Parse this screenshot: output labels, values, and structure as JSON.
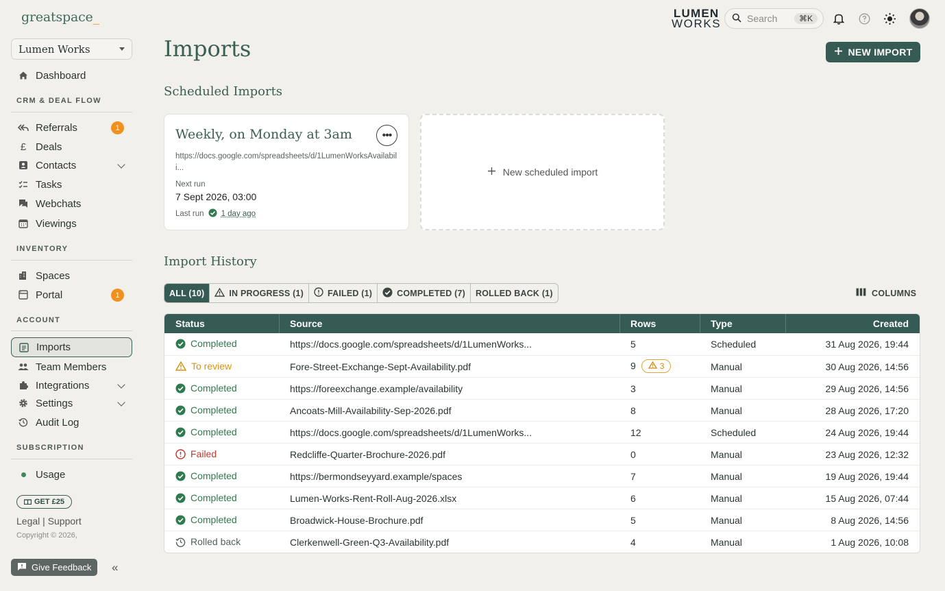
{
  "brand": {
    "name": "greatspace",
    "cursor": "_"
  },
  "org_select": {
    "value": "Lumen Works"
  },
  "sidebar": {
    "dashboard": "Dashboard",
    "crm_section": "CRM & DEAL FLOW",
    "referrals": "Referrals",
    "referrals_badge": "1",
    "deals": "Deals",
    "contacts": "Contacts",
    "tasks": "Tasks",
    "webchats": "Webchats",
    "viewings": "Viewings",
    "inventory_section": "INVENTORY",
    "spaces": "Spaces",
    "portal": "Portal",
    "portal_badge": "1",
    "account_section": "ACCOUNT",
    "imports": "Imports",
    "team_members": "Team Members",
    "integrations": "Integrations",
    "settings": "Settings",
    "audit_log": "Audit Log",
    "subscription_section": "SUBSCRIPTION",
    "usage": "Usage",
    "get_offer": "GET £25",
    "legal": "Legal",
    "support": "Support",
    "copyright": "Copyright © 2026,",
    "feedback": "Give Feedback",
    "collapse": "«"
  },
  "topbar": {
    "client_logo_line1": "LUMEN",
    "client_logo_line2": "WORKS",
    "search_placeholder": "Search",
    "search_shortcut": "⌘K"
  },
  "page": {
    "title": "Imports",
    "new_import_label": "NEW IMPORT",
    "scheduled_heading": "Scheduled Imports",
    "history_heading": "Import History"
  },
  "scheduled_card": {
    "title": "Weekly, on Monday at 3am",
    "url": "https://docs.google.com/spreadsheets/d/1LumenWorksAvailabili...",
    "next_run_label": "Next run",
    "next_run_value": "7 Sept 2026, 03:00",
    "last_run_label": "Last run",
    "last_run_value": "1 day ago"
  },
  "new_scheduled_label": "New scheduled import",
  "filters": [
    {
      "label": "ALL (10)",
      "icon": "none"
    },
    {
      "label": "IN PROGRESS (1)",
      "icon": "warning-icon"
    },
    {
      "label": "FAILED (1)",
      "icon": "alert-circle-icon"
    },
    {
      "label": "COMPLETED (7)",
      "icon": "check-circle-icon"
    },
    {
      "label": "ROLLED BACK (1)",
      "icon": "none"
    }
  ],
  "columns_label": "COLUMNS",
  "table": {
    "headers": {
      "status": "Status",
      "source": "Source",
      "rows": "Rows",
      "type": "Type",
      "created": "Created"
    },
    "rows": [
      {
        "status": "Completed",
        "source": "https://docs.google.com/spreadsheets/d/1LumenWorks...",
        "rows": "5",
        "type": "Scheduled",
        "created": "31 Aug 2026, 19:44"
      },
      {
        "status": "To review",
        "source": "Fore-Street-Exchange-Sept-Availability.pdf",
        "rows": "9",
        "warnings": "3",
        "type": "Manual",
        "created": "30 Aug 2026, 14:56"
      },
      {
        "status": "Completed",
        "source": "https://foreexchange.example/availability",
        "rows": "3",
        "type": "Manual",
        "created": "29 Aug 2026, 14:56"
      },
      {
        "status": "Completed",
        "source": "Ancoats-Mill-Availability-Sep-2026.pdf",
        "rows": "8",
        "type": "Manual",
        "created": "28 Aug 2026, 17:20"
      },
      {
        "status": "Completed",
        "source": "https://docs.google.com/spreadsheets/d/1LumenWorks...",
        "rows": "12",
        "type": "Scheduled",
        "created": "24 Aug 2026, 19:44"
      },
      {
        "status": "Failed",
        "source": "Redcliffe-Quarter-Brochure-2026.pdf",
        "rows": "0",
        "type": "Manual",
        "created": "23 Aug 2026, 12:32"
      },
      {
        "status": "Completed",
        "source": "https://bermondseyyard.example/spaces",
        "rows": "7",
        "type": "Manual",
        "created": "19 Aug 2026, 19:44"
      },
      {
        "status": "Completed",
        "source": "Lumen-Works-Rent-Roll-Aug-2026.xlsx",
        "rows": "6",
        "type": "Manual",
        "created": "15 Aug 2026, 07:44"
      },
      {
        "status": "Completed",
        "source": "Broadwick-House-Brochure.pdf",
        "rows": "5",
        "type": "Manual",
        "created": "8 Aug 2026, 14:56"
      },
      {
        "status": "Rolled back",
        "source": "Clerkenwell-Green-Q3-Availability.pdf",
        "rows": "4",
        "type": "Manual",
        "created": "1 Aug 2026, 10:08"
      }
    ]
  },
  "colors": {
    "primary": "#365b54",
    "heading": "#3b5e55",
    "badge": "#f0901e",
    "completed": "#2f7a4e",
    "review": "#d99414",
    "failed": "#c03a32",
    "background": "#f1f0eb"
  }
}
